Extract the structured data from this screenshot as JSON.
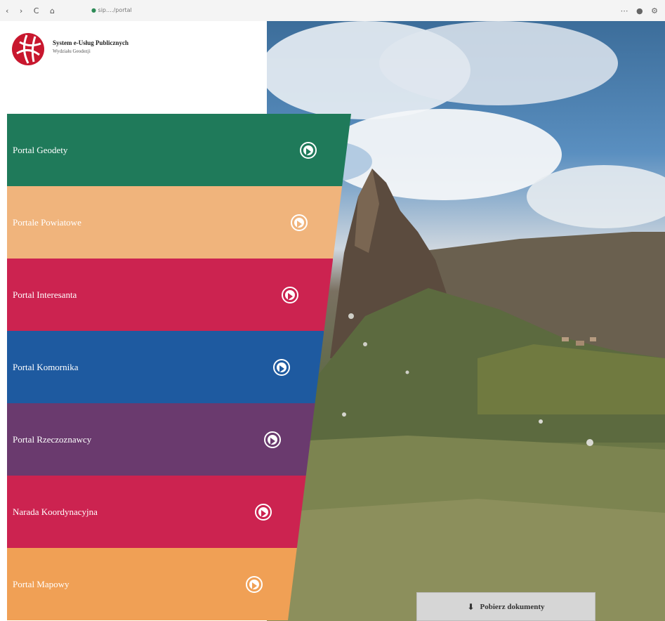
{
  "browser": {
    "nav_icons": "‹ › C ⌂",
    "url": "sip.…/portal",
    "controls": "⋯ ● ⚙"
  },
  "brand": {
    "title": "System e-Usług Publicznych",
    "subtitle": "Wydziału Geodezji"
  },
  "menu": {
    "items": [
      {
        "label": "Portal Geodety",
        "color": "#1f7a5a"
      },
      {
        "label": "Portale Powiatowe",
        "color": "#f0b47c"
      },
      {
        "label": "Portal Interesanta",
        "color": "#cc2350"
      },
      {
        "label": "Portal Komornika",
        "color": "#1e5aa0"
      },
      {
        "label": "Portal Rzeczoznawcy",
        "color": "#6a3a6e"
      },
      {
        "label": "Narada Koordynacyjna",
        "color": "#cc2350"
      },
      {
        "label": "Portal Mapowy",
        "color": "#f0a055"
      }
    ]
  },
  "download": {
    "label": "Pobierz dokumenty",
    "icon": "download-icon"
  }
}
